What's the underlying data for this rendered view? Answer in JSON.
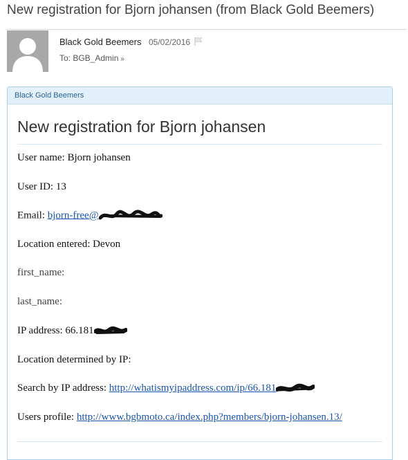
{
  "message": {
    "subject": "New registration for Bjorn johansen (from Black Gold Beemers)",
    "sender": "Black Gold Beemers",
    "date": "05/02/2016",
    "to_label": "To: BGB_Admin",
    "to_chevron": "»"
  },
  "card": {
    "header": "Black Gold Beemers",
    "heading": "New registration for Bjorn johansen",
    "fields": {
      "user_name": "User name: Bjorn johansen",
      "user_id": "User ID: 13",
      "email_label": "Email: ",
      "email_link": "bjorn-free@",
      "location_entered": "Location entered: Devon",
      "first_name": "first_name:",
      "last_name": "last_name:",
      "ip_address": "IP address: 66.181",
      "location_determined": "Location determined by IP:",
      "search_label": "Search by IP address: ",
      "search_link": "http://whatismyipaddress.com/ip/66.181",
      "profile_label": "Users profile: ",
      "profile_link": "http://www.bgbmoto.ca/index.php?members/bjorn-johansen.13/"
    }
  },
  "colors": {
    "card_border": "#a9cfe8",
    "card_header_bg": "#e1f0fa",
    "link": "#1a55b0",
    "avatar_bg": "#a8a8a8"
  },
  "icons": [
    "avatar-placeholder-icon",
    "flag-icon",
    "chevron-down-icon",
    "redaction-scribble"
  ]
}
